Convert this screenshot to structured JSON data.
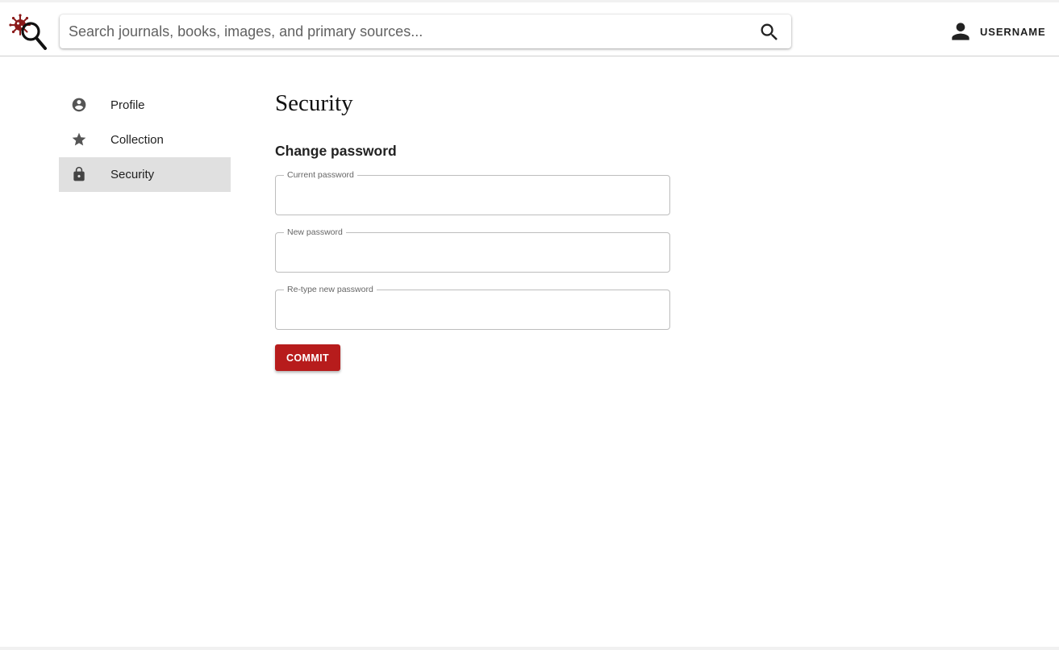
{
  "header": {
    "search_placeholder": "Search journals, books, images, and primary sources...",
    "user_label": "USERNAME"
  },
  "sidebar": {
    "items": [
      {
        "label": "Profile",
        "icon": "account-circle-icon"
      },
      {
        "label": "Collection",
        "icon": "star-icon"
      },
      {
        "label": "Security",
        "icon": "lock-icon",
        "active": true
      }
    ]
  },
  "main": {
    "title": "Security",
    "section_title": "Change password",
    "fields": [
      {
        "label": "Current password",
        "value": ""
      },
      {
        "label": "New password",
        "value": ""
      },
      {
        "label": "Re-type new password",
        "value": ""
      }
    ],
    "commit_label": "COMMIT"
  },
  "colors": {
    "accent": "#b71c1c",
    "active_nav_bg": "#e0e0e0",
    "logo_virus": "#8b1a1a"
  }
}
